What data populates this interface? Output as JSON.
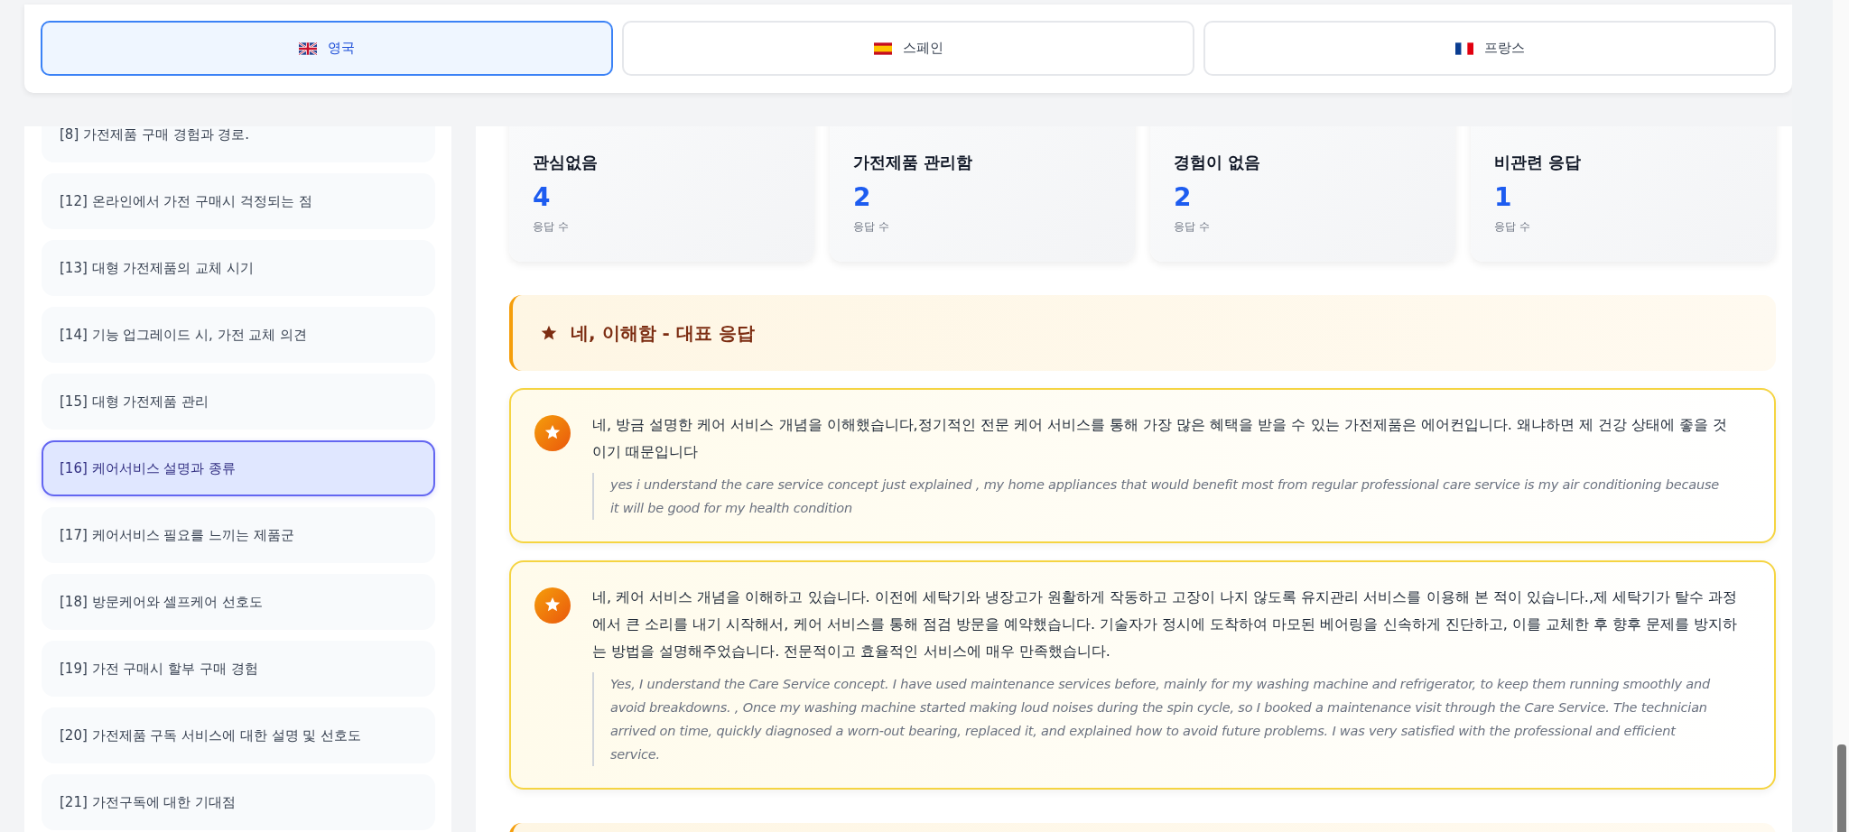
{
  "tabs": [
    {
      "label": "영국",
      "selected": true
    },
    {
      "label": "스페인",
      "selected": false
    },
    {
      "label": "프랑스",
      "selected": false
    }
  ],
  "sidebar": {
    "items": [
      {
        "label": "[8] 가전제품 구매 경험과 경로.",
        "selected": false
      },
      {
        "label": "[12] 온라인에서 가전 구매시 걱정되는 점",
        "selected": false
      },
      {
        "label": "[13] 대형 가전제품의 교체 시기",
        "selected": false
      },
      {
        "label": "[14] 기능 업그레이드 시, 가전 교체 의견",
        "selected": false
      },
      {
        "label": "[15] 대형 가전제품 관리",
        "selected": false
      },
      {
        "label": "[16] 케어서비스 설명과 종류",
        "selected": true
      },
      {
        "label": "[17] 케어서비스 필요를 느끼는 제품군",
        "selected": false
      },
      {
        "label": "[18] 방문케어와 셀프케어 선호도",
        "selected": false
      },
      {
        "label": "[19] 가전 구매시 할부 구매 경험",
        "selected": false
      },
      {
        "label": "[20] 가전제품 구독 서비스에 대한 설명 및 선호도",
        "selected": false
      },
      {
        "label": "[21] 가전구독에 대한 기대점",
        "selected": false
      }
    ]
  },
  "stats": [
    {
      "title": "관심없음",
      "value": "4",
      "caption": "응답 수"
    },
    {
      "title": "가전제품 관리함",
      "value": "2",
      "caption": "응답 수"
    },
    {
      "title": "경험이 없음",
      "value": "2",
      "caption": "응답 수"
    },
    {
      "title": "비관련 응답",
      "value": "1",
      "caption": "응답 수"
    }
  ],
  "sections": [
    {
      "title": "네, 이해함 - 대표 응답",
      "responses": [
        {
          "text": "네, 방금 설명한 케어 서비스 개념을 이해했습니다,정기적인 전문 케어 서비스를 통해 가장 많은 혜택을 받을 수 있는 가전제품은 에어컨입니다. 왜냐하면 제 건강 상태에 좋을 것이기 때문입니다",
          "translation": "yes i understand the care service concept just explained , my home appliances that would benefit most from regular professional care service is my air conditioning because it will be good for my health condition"
        },
        {
          "text": "네, 케어 서비스 개념을 이해하고 있습니다. 이전에 세탁기와 냉장고가 원활하게 작동하고 고장이 나지 않도록 유지관리 서비스를 이용해 본 적이 있습니다.,제 세탁기가 탈수 과정에서 큰 소리를 내기 시작해서, 케어 서비스를 통해 점검 방문을 예약했습니다. 기술자가 정시에 도착하여 마모된 베어링을 신속하게 진단하고, 이를 교체한 후 향후 문제를 방지하는 방법을 설명해주었습니다. 전문적이고 효율적인 서비스에 매우 만족했습니다.",
          "translation": "Yes, I understand the Care Service concept. I have used maintenance services before, mainly for my washing machine and refrigerator, to keep them running smoothly and avoid breakdowns. , Once my washing machine started making loud noises during the spin cycle, so I booked a maintenance visit through the Care Service. The technician arrived on time, quickly diagnosed a worn-out bearing, replaced it, and explained how to avoid future problems. I was very satisfied with the professional and efficient service."
        }
      ]
    }
  ]
}
